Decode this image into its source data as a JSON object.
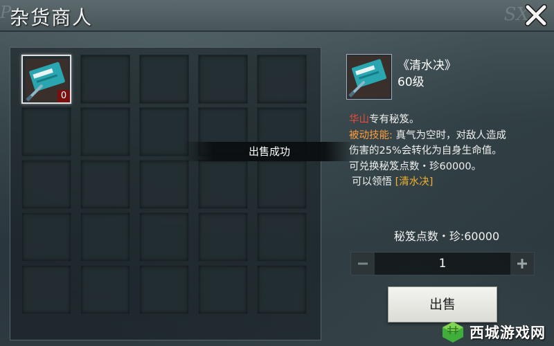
{
  "header": {
    "title": "杂货商人",
    "deco_right": "SX",
    "deco_left": "P"
  },
  "inventory": {
    "slot_count": 25,
    "selected_item": {
      "icon": "blue-book-sword-icon",
      "count": "0"
    }
  },
  "toast": {
    "message": "出售成功"
  },
  "detail": {
    "name": "《清水决》",
    "level": "60级",
    "line1_red": "华山",
    "line1_rest": "专有秘笈。",
    "line2_orange": "被动技能:",
    "line2_rest": " 真气为空时，对敌人造成",
    "line3": "伤害的25%会转化为自身生命值。",
    "line4": "可兑换秘笈点数・珍60000。",
    "line5_prefix": "可以领悟 ",
    "line5_gold": "[清水决]"
  },
  "purchase": {
    "points_label": "秘笈点数・珍:60000",
    "quantity": "1",
    "sell_label": "出售"
  },
  "watermark": {
    "text": "西城游戏网"
  },
  "colors": {
    "accent_red": "#e84a3c",
    "accent_orange": "#ff9d3c",
    "accent_gold": "#f0b030",
    "count_badge": "#7a0f0f"
  }
}
